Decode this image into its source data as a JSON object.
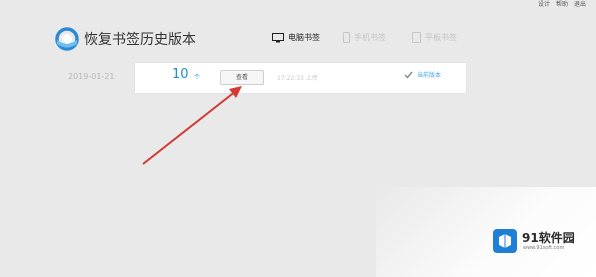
{
  "top_links": [
    "设计",
    "帮助",
    "退出"
  ],
  "app": {
    "title": "恢复书签历史版本"
  },
  "tabs": {
    "pc": "电脑书签",
    "mobile": "手机书签",
    "pad": "平板书签"
  },
  "record": {
    "label": "2019-01-21",
    "count": "10",
    "unit": "个",
    "view_button": "查看",
    "time": "17:22:33 上传",
    "status": "当前版本"
  },
  "watermark": {
    "text": "91软件园",
    "sub": "www.91soft.com"
  },
  "colors": {
    "accent": "#1a8fd1",
    "arrow": "#d23a33",
    "background": "#e9e9e9"
  }
}
